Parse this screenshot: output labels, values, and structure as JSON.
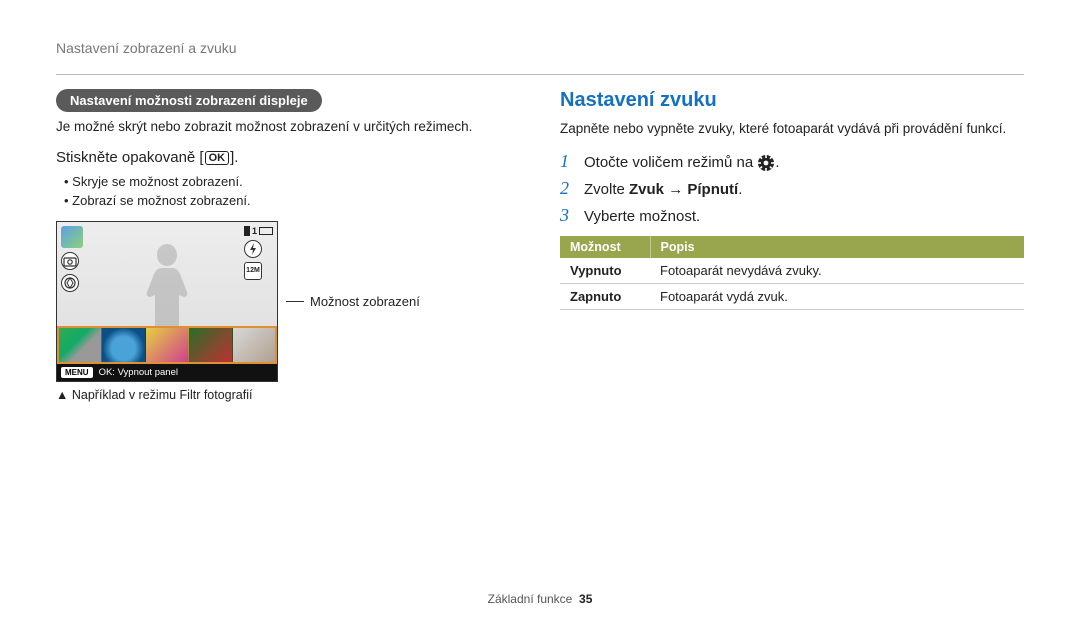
{
  "header": {
    "title": "Nastavení zobrazení a zvuku"
  },
  "left": {
    "pill": "Nastavení možnosti zobrazení displeje",
    "intro": "Je možné skrýt nebo zobrazit možnost zobrazení v určitých režimech.",
    "press_prefix": "Stiskněte opakovaně [",
    "press_ok": "OK",
    "press_suffix": "].",
    "bullets": [
      "Skryje se možnost zobrazení.",
      "Zobrazí se možnost zobrazení."
    ],
    "cam": {
      "counter": "1",
      "menu_chip": "MENU",
      "footer_text": "OK: Vypnout panel"
    },
    "callout": "Možnost zobrazení",
    "caption": "Například v režimu Filtr fotografií"
  },
  "right": {
    "title": "Nastavení zvuku",
    "intro": "Zapněte nebo vypněte zvuky, které fotoaparát vydává při provádění funkcí.",
    "steps": [
      {
        "num": "1",
        "prefix": "Otočte voličem režimů na ",
        "suffix": "."
      },
      {
        "num": "2",
        "prefix": "Zvolte ",
        "b1": "Zvuk",
        "b2": "Pípnutí",
        "suffix": "."
      },
      {
        "num": "3",
        "text": "Vyberte možnost."
      }
    ],
    "table": {
      "head": {
        "opt": "Možnost",
        "desc": "Popis"
      },
      "rows": [
        {
          "opt": "Vypnuto",
          "desc": "Fotoaparát nevydává zvuky."
        },
        {
          "opt": "Zapnuto",
          "desc": "Fotoaparát vydá zvuk."
        }
      ]
    }
  },
  "footer": {
    "label": "Základní funkce",
    "page": "35"
  }
}
